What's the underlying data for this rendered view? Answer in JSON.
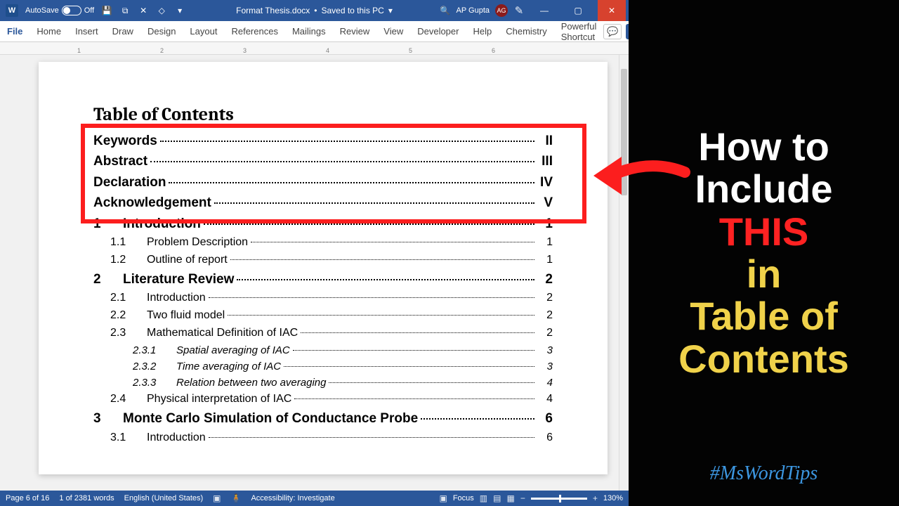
{
  "titlebar": {
    "autosave_label": "AutoSave",
    "autosave_state": "Off",
    "doc_name": "Format Thesis.docx",
    "doc_status": "Saved to this PC",
    "user_name": "AP Gupta",
    "user_initials": "AG"
  },
  "ribbon": {
    "tabs": [
      "File",
      "Home",
      "Insert",
      "Draw",
      "Design",
      "Layout",
      "References",
      "Mailings",
      "Review",
      "View",
      "Developer",
      "Help",
      "Chemistry",
      "Powerful Shortcut"
    ],
    "active_index": 1
  },
  "ruler": {
    "numbers": [
      "1",
      "2",
      "3",
      "4",
      "5",
      "6"
    ]
  },
  "toc": {
    "title": "Table of Contents",
    "rows": [
      {
        "level": 1,
        "num": "",
        "title": "Keywords",
        "page": "II",
        "bold": true
      },
      {
        "level": 1,
        "num": "",
        "title": "Abstract",
        "page": "III",
        "bold": true
      },
      {
        "level": 1,
        "num": "",
        "title": "Declaration",
        "page": "IV",
        "bold": true
      },
      {
        "level": 1,
        "num": "",
        "title": "Acknowledgement",
        "page": "V",
        "bold": true
      },
      {
        "level": 1,
        "num": "1",
        "title": "Introduction",
        "page": "1",
        "bold": true
      },
      {
        "level": 2,
        "num": "1.1",
        "title": "Problem Description",
        "page": "1"
      },
      {
        "level": 2,
        "num": "1.2",
        "title": "Outline of report",
        "page": "1"
      },
      {
        "level": 1,
        "num": "2",
        "title": "Literature Review",
        "page": "2",
        "bold": true
      },
      {
        "level": 2,
        "num": "2.1",
        "title": "Introduction",
        "page": "2"
      },
      {
        "level": 2,
        "num": "2.2",
        "title": "Two fluid model",
        "page": "2"
      },
      {
        "level": 2,
        "num": "2.3",
        "title": "Mathematical Definition of IAC",
        "page": "2"
      },
      {
        "level": 3,
        "num": "2.3.1",
        "title": "Spatial averaging of IAC",
        "page": "3"
      },
      {
        "level": 3,
        "num": "2.3.2",
        "title": "Time averaging of IAC",
        "page": "3"
      },
      {
        "level": 3,
        "num": "2.3.3",
        "title": "Relation between two averaging",
        "page": "4"
      },
      {
        "level": 2,
        "num": "2.4",
        "title": "Physical interpretation of IAC",
        "page": "4"
      },
      {
        "level": 1,
        "num": "3",
        "title": "Monte Carlo Simulation of Conductance Probe",
        "page": "6",
        "bold": true
      },
      {
        "level": 2,
        "num": "3.1",
        "title": "Introduction",
        "page": "6"
      }
    ]
  },
  "statusbar": {
    "page": "Page 6 of 16",
    "words": "1 of 2381 words",
    "lang": "English (United States)",
    "access": "Accessibility: Investigate",
    "focus": "Focus",
    "zoom": "130%"
  },
  "overlay": {
    "line1": "How to",
    "line2": "Include",
    "line3": "THIS",
    "line4": "in",
    "line5": "Table of",
    "line6": "Contents",
    "hashtag": "#MsWordTips"
  }
}
